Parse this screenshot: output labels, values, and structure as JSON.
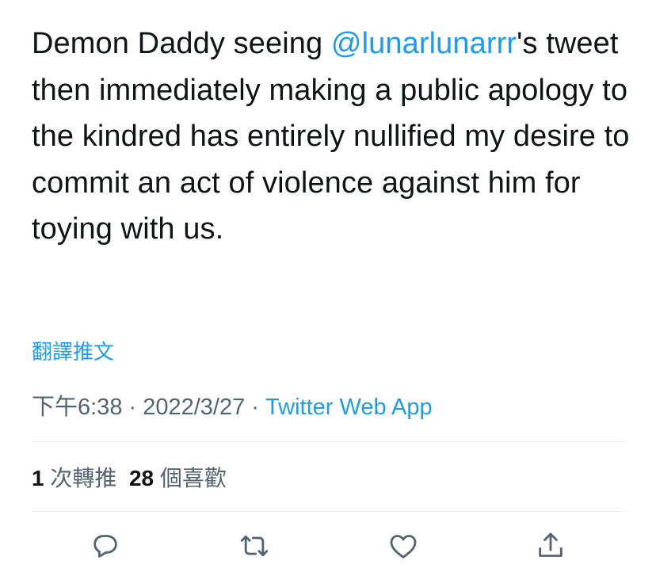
{
  "tweet": {
    "text_before": "Demon Daddy seeing ",
    "mention": "@lunarlunarrr",
    "text_after": "'s tweet then immediately making a public apology to the kindred has entirely nullified my desire to commit an act of violence against him for toying with us.",
    "translate_label": "翻譯推文"
  },
  "meta": {
    "time": "下午6:38",
    "sep1": " · ",
    "date": "2022/3/27",
    "sep2": " · ",
    "source": "Twitter Web App"
  },
  "stats": {
    "retweets_count": "1",
    "retweets_label": "次轉推",
    "likes_count": "28",
    "likes_label": "個喜歡"
  },
  "actions": {
    "icons": [
      "reply-icon",
      "retweet-icon",
      "like-icon",
      "share-icon"
    ]
  },
  "colors": {
    "accent": "#1d9bf0",
    "text": "#0f1419",
    "secondary": "#536471",
    "divider": "#e6ecf0"
  }
}
